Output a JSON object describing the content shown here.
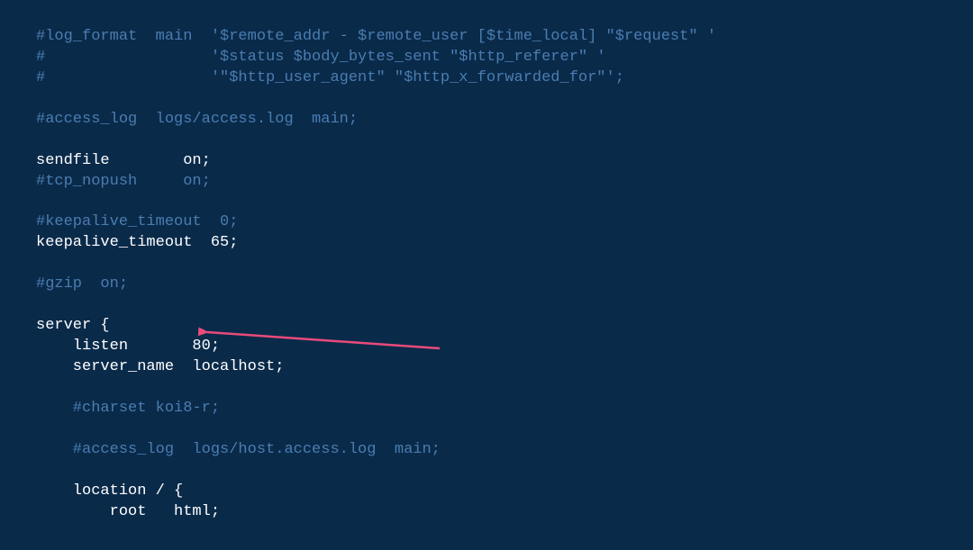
{
  "lines": [
    {
      "cls": "comment",
      "text": "#log_format  main  '$remote_addr - $remote_user [$time_local] \"$request\" '"
    },
    {
      "cls": "comment",
      "text": "#                  '$status $body_bytes_sent \"$http_referer\" '"
    },
    {
      "cls": "comment",
      "text": "#                  '\"$http_user_agent\" \"$http_x_forwarded_for\"';"
    },
    {
      "cls": "comment",
      "text": ""
    },
    {
      "cls": "comment",
      "text": "#access_log  logs/access.log  main;"
    },
    {
      "cls": "comment",
      "text": ""
    },
    {
      "cls": "active",
      "text": "sendfile        on;"
    },
    {
      "cls": "comment",
      "text": "#tcp_nopush     on;"
    },
    {
      "cls": "comment",
      "text": ""
    },
    {
      "cls": "comment",
      "text": "#keepalive_timeout  0;"
    },
    {
      "cls": "active",
      "text": "keepalive_timeout  65;"
    },
    {
      "cls": "comment",
      "text": ""
    },
    {
      "cls": "comment",
      "text": "#gzip  on;"
    },
    {
      "cls": "comment",
      "text": ""
    },
    {
      "cls": "active",
      "text": "server {"
    },
    {
      "cls": "active",
      "text": "    listen       80;"
    },
    {
      "cls": "active",
      "text": "    server_name  localhost;"
    },
    {
      "cls": "comment",
      "text": ""
    },
    {
      "cls": "comment",
      "text": "    #charset koi8-r;"
    },
    {
      "cls": "comment",
      "text": ""
    },
    {
      "cls": "comment",
      "text": "    #access_log  logs/host.access.log  main;"
    },
    {
      "cls": "comment",
      "text": ""
    },
    {
      "cls": "active",
      "text": "    location / {"
    },
    {
      "cls": "active",
      "text": "        root   html;"
    }
  ],
  "annotation": {
    "arrow_color": "#e94b7a"
  }
}
